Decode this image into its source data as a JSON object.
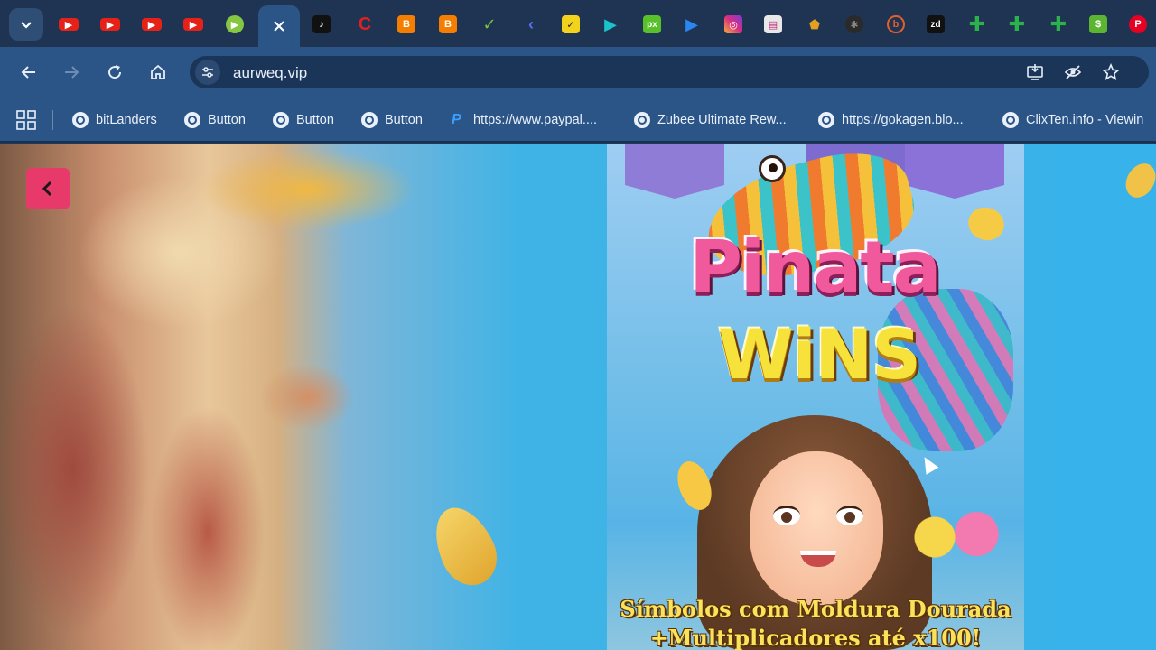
{
  "browser": {
    "tabs": [
      {
        "icon": "youtube-icon",
        "color": "#e62117"
      },
      {
        "icon": "youtube-icon",
        "color": "#e62117"
      },
      {
        "icon": "youtube-icon",
        "color": "#e62117"
      },
      {
        "icon": "youtube-icon",
        "color": "#e62117"
      },
      {
        "icon": "rumble-icon",
        "color": "#85c742"
      },
      {
        "icon": "close-icon",
        "active": true
      },
      {
        "icon": "tiktok-icon",
        "color": "#111111"
      },
      {
        "icon": "red-c-icon",
        "color": "#e02020"
      },
      {
        "icon": "blogger-icon",
        "color": "#f57d00"
      },
      {
        "icon": "blogger-icon",
        "color": "#f57d00"
      },
      {
        "icon": "green-check-icon",
        "color": "#7ac143"
      },
      {
        "icon": "arrow-icon",
        "color": "#5b6ef0"
      },
      {
        "icon": "yellow-check-icon",
        "color": "#f3d21c"
      },
      {
        "icon": "play-icon",
        "color": "#19c3c9"
      },
      {
        "icon": "px-icon",
        "color": "#58c12a"
      },
      {
        "icon": "play-icon",
        "color": "#2a86f0"
      },
      {
        "icon": "instagram-icon",
        "color": "#d92f7f"
      },
      {
        "icon": "document-icon",
        "color": "#e8e8e8"
      },
      {
        "icon": "shield-icon",
        "color": "#e2a020"
      },
      {
        "icon": "gear-icon",
        "color": "#2a2a2a"
      },
      {
        "icon": "b-circle-icon",
        "color": "#e0602c"
      },
      {
        "icon": "zd-icon",
        "color": "#111111"
      },
      {
        "icon": "plus-icon",
        "color": "#2bb24c"
      },
      {
        "icon": "plus-icon",
        "color": "#2bb24c"
      },
      {
        "icon": "plus-icon",
        "color": "#2bb24c"
      },
      {
        "icon": "dollar-icon",
        "color": "#5cb531"
      },
      {
        "icon": "pinterest-icon",
        "color": "#e60023"
      }
    ],
    "url": "aurweq.vip",
    "bookmarks": [
      {
        "label": "bitLanders",
        "icon": "globe-icon"
      },
      {
        "label": "Button",
        "icon": "globe-icon"
      },
      {
        "label": "Button",
        "icon": "globe-icon"
      },
      {
        "label": "Button",
        "icon": "globe-icon"
      },
      {
        "label": "https://www.paypal....",
        "icon": "paypal-icon"
      },
      {
        "label": "Zubee Ultimate Rew...",
        "icon": "globe-icon"
      },
      {
        "label": "https://gokagen.blo...",
        "icon": "globe-icon"
      },
      {
        "label": "ClixTen.info - Viewin",
        "icon": "globe-icon"
      }
    ]
  },
  "game": {
    "logo_line1": "Pinata",
    "logo_line2": "WiNS",
    "caption_line1": "Símbolos com Moldura Dourada",
    "caption_line2": "+Multiplicadores até x100!"
  },
  "colors": {
    "back_button": "#e8396b",
    "toolbar": "#2b5487",
    "tabstrip": "#1e3452"
  }
}
